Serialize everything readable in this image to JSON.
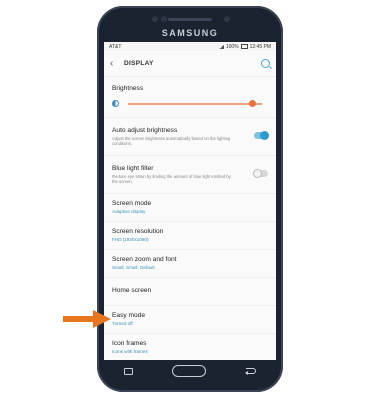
{
  "device": {
    "brand": "SAMSUNG"
  },
  "status_bar": {
    "carrier": "AT&T",
    "battery": "100%",
    "time": "12:45 PM"
  },
  "header": {
    "title": "DISPLAY"
  },
  "brightness": {
    "label": "Brightness",
    "level": 0.93
  },
  "settings": [
    {
      "title": "Auto adjust brightness",
      "subtitle": "Adjust the screen brightness automatically based on the lighting conditions.",
      "toggle": "on"
    },
    {
      "title": "Blue light filter",
      "subtitle": "Reduce eye strain by limiting the amount of blue light emitted by the screen.",
      "toggle": "off"
    }
  ],
  "items": [
    {
      "title": "Screen mode",
      "value": "Adaptive display"
    },
    {
      "title": "Screen resolution",
      "value": "FHD (1920x1080)"
    },
    {
      "title": "Screen zoom and font",
      "value": "Small, Small, Default"
    },
    {
      "title": "Home screen",
      "value": ""
    },
    {
      "title": "Easy mode",
      "value": "Turned off"
    },
    {
      "title": "Icon frames",
      "value": "Icons with frames"
    }
  ],
  "colors": {
    "accent": "#3a8fbc",
    "slider": "#e8713c",
    "callout_arrow": "#e8761f",
    "phone_body": "#1c2330"
  }
}
